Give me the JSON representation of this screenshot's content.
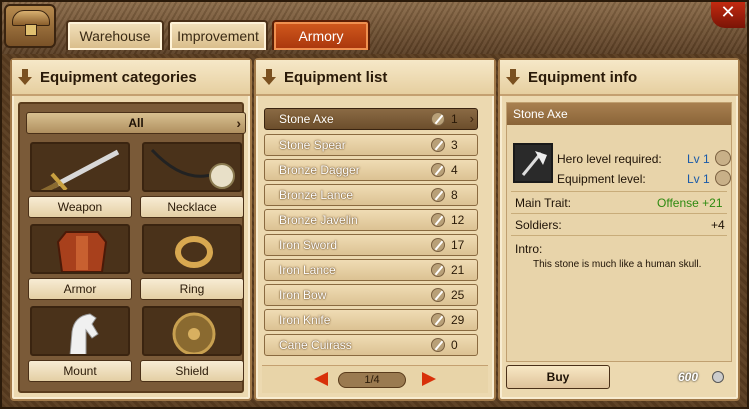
{
  "tabs": [
    {
      "label": "Warehouse"
    },
    {
      "label": "Improvement"
    },
    {
      "label": "Armory"
    }
  ],
  "active_tab": "Armory",
  "close_label": "✕",
  "categories": {
    "title": "Equipment categories",
    "all_label": "All",
    "items": [
      {
        "label": "Weapon"
      },
      {
        "label": "Necklace"
      },
      {
        "label": "Armor"
      },
      {
        "label": "Ring"
      },
      {
        "label": "Mount"
      },
      {
        "label": "Shield"
      }
    ]
  },
  "list": {
    "title": "Equipment list",
    "items": [
      {
        "name": "Stone Axe",
        "value": "1"
      },
      {
        "name": "Stone Spear",
        "value": "3"
      },
      {
        "name": "Bronze Dagger",
        "value": "4"
      },
      {
        "name": "Bronze Lance",
        "value": "8"
      },
      {
        "name": "Bronze Javelin",
        "value": "12"
      },
      {
        "name": "Iron Sword",
        "value": "17"
      },
      {
        "name": "Iron Lance",
        "value": "21"
      },
      {
        "name": "Iron Bow",
        "value": "25"
      },
      {
        "name": "Iron Knife",
        "value": "29"
      },
      {
        "name": "Cane Cuirass",
        "value": "0"
      }
    ],
    "page": "1/4"
  },
  "info": {
    "title": "Equipment info",
    "item_name": "Stone Axe",
    "hero_level_label": "Hero level required:",
    "hero_level_value": "Lv 1",
    "equip_level_label": "Equipment level:",
    "equip_level_value": "Lv 1",
    "main_trait_label": "Main Trait:",
    "main_trait_value": "Offense +21",
    "soldiers_label": "Soldiers:",
    "soldiers_value": "+4",
    "intro_label": "Intro:",
    "intro_text": "This stone is much like a human skull.",
    "buy_label": "Buy",
    "price": "600"
  },
  "colors": {
    "accent": "#c0440f",
    "trait_green": "#2e8a10",
    "level_blue": "#1a5aa8"
  }
}
